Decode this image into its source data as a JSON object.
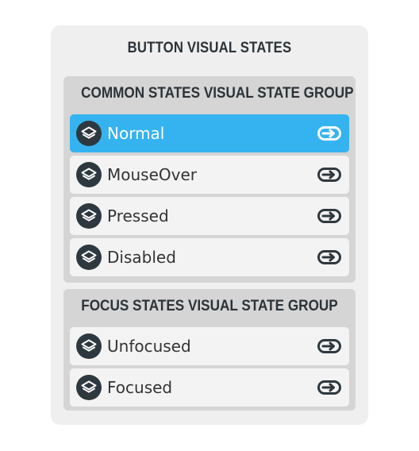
{
  "title": "BUTTON VISUAL STATES",
  "groups": [
    {
      "title": "COMMON STATES VISUAL STATE GROUP",
      "states": [
        "Normal",
        "MouseOver",
        "Pressed",
        "Disabled"
      ]
    },
    {
      "title": "FOCUS STATES VISUAL STATE GROUP",
      "states": [
        "Unfocused",
        "Focused"
      ]
    }
  ],
  "active_state": "Normal",
  "icons": {
    "state": "layers-icon",
    "transition": "link-arrow-icon"
  },
  "colors": {
    "active": "#35b3f0",
    "panel": "#efefef",
    "group": "#d5d5d5",
    "item": "#f3f3f3",
    "text": "#333333",
    "icon_dark": "#2e383f"
  }
}
